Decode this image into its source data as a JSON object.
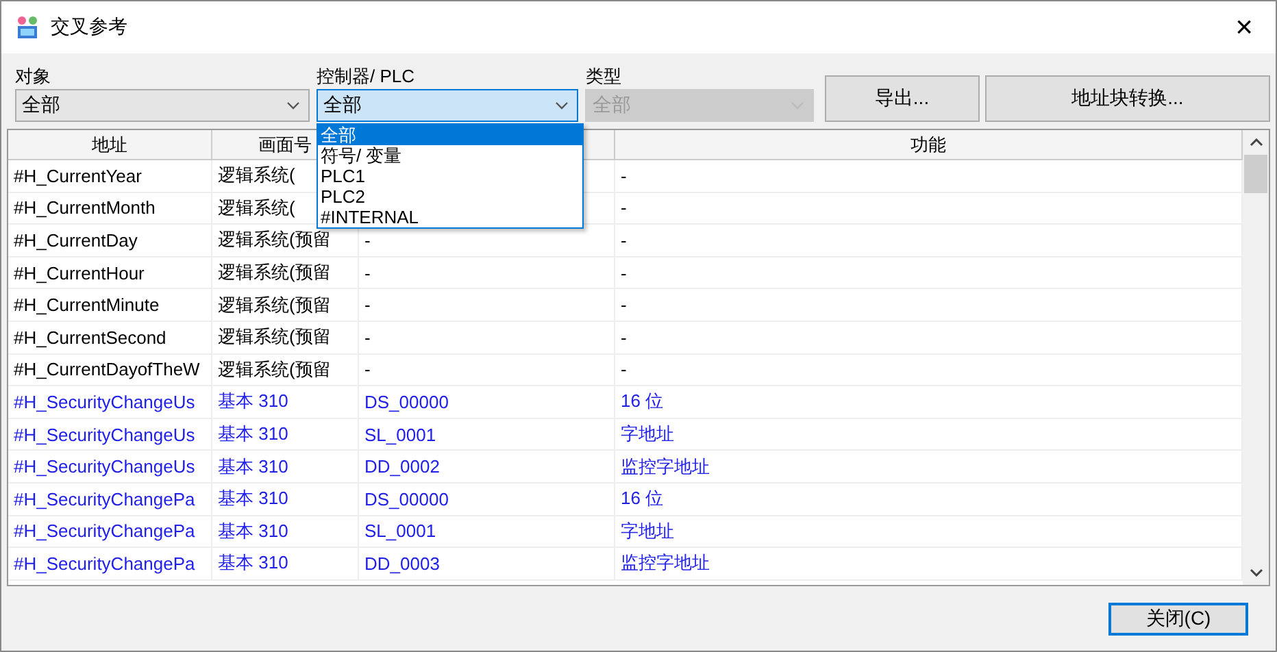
{
  "window": {
    "title": "交叉参考",
    "close": "×"
  },
  "filters": [
    {
      "label": "对象",
      "value": "全部",
      "disabled": false,
      "open": false
    },
    {
      "label": "控制器/ PLC",
      "value": "全部",
      "disabled": false,
      "open": true
    },
    {
      "label": "类型",
      "value": "全部",
      "disabled": true,
      "open": false
    }
  ],
  "buttons": [
    "导出...",
    "地址块转换..."
  ],
  "dropdown": [
    {
      "label": "全部",
      "selected": true
    },
    {
      "label": "符号/ 变量",
      "selected": false
    },
    {
      "label": "PLC1",
      "selected": false
    },
    {
      "label": "PLC2",
      "selected": false
    },
    {
      "label": "#INTERNAL",
      "selected": false
    }
  ],
  "table": {
    "columns": [
      "地址",
      "画面号",
      null,
      "功能"
    ],
    "rows": [
      {
        "color": "#000000",
        "cells": [
          "#H_CurrentYear",
          "逻辑系统(",
          null,
          "-"
        ]
      },
      {
        "color": "#000000",
        "cells": [
          "#H_CurrentMonth",
          "逻辑系统(",
          null,
          "-"
        ]
      },
      {
        "color": "#000000",
        "cells": [
          "#H_CurrentDay",
          "逻辑系统(预留",
          "-",
          "-"
        ]
      },
      {
        "color": "#000000",
        "cells": [
          "#H_CurrentHour",
          "逻辑系统(预留",
          "-",
          "-"
        ]
      },
      {
        "color": "#000000",
        "cells": [
          "#H_CurrentMinute",
          "逻辑系统(预留",
          "-",
          "-"
        ]
      },
      {
        "color": "#000000",
        "cells": [
          "#H_CurrentSecond",
          "逻辑系统(预留",
          "-",
          "-"
        ]
      },
      {
        "color": "#000000",
        "cells": [
          "#H_CurrentDayofTheW",
          "逻辑系统(预留",
          "-",
          "-"
        ]
      },
      {
        "color": "#2020e8",
        "cells": [
          "#H_SecurityChangeUs",
          "基本 310",
          "DS_00000",
          "16 位"
        ]
      },
      {
        "color": "#2020e8",
        "cells": [
          "#H_SecurityChangeUs",
          "基本 310",
          "SL_0001",
          "字地址"
        ]
      },
      {
        "color": "#2020e8",
        "cells": [
          "#H_SecurityChangeUs",
          "基本 310",
          "DD_0002",
          "监控字地址"
        ]
      },
      {
        "color": "#2020e8",
        "cells": [
          "#H_SecurityChangePa",
          "基本 310",
          "DS_00000",
          "16 位"
        ]
      },
      {
        "color": "#2020e8",
        "cells": [
          "#H_SecurityChangePa",
          "基本 310",
          "SL_0001",
          "字地址"
        ]
      },
      {
        "color": "#2020e8",
        "cells": [
          "#H_SecurityChangePa",
          "基本 310",
          "DD_0003",
          "监控字地址"
        ]
      }
    ]
  },
  "close_button": "关闭(C)"
}
